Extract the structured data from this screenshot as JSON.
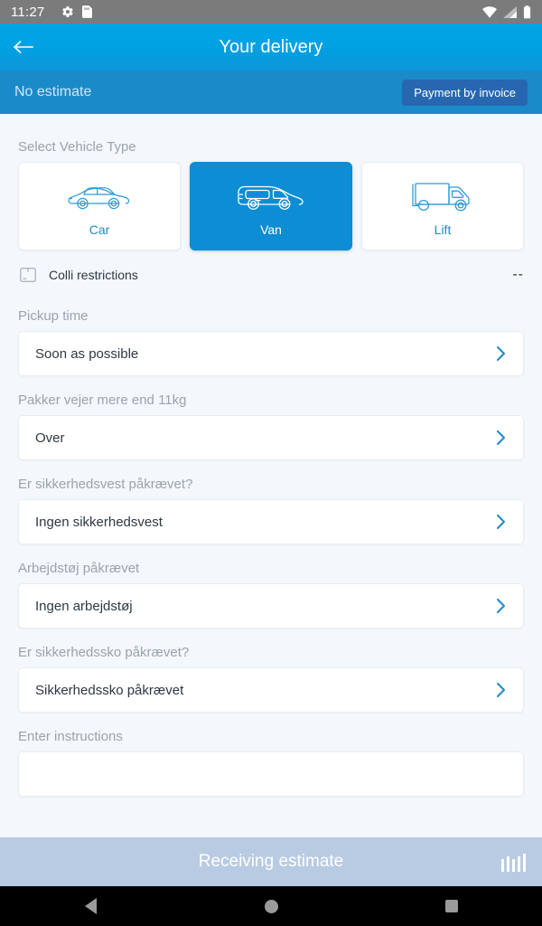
{
  "statusbar": {
    "time": "11:27",
    "icons_left": [
      "gear-icon",
      "sd-card-icon"
    ],
    "icons_right": [
      "wifi-icon",
      "signal-icon",
      "battery-icon"
    ]
  },
  "header": {
    "title": "Your delivery",
    "back_icon": "back-arrow-icon",
    "estimate_text": "No estimate",
    "payment_button": "Payment by invoice"
  },
  "vehicle_section": {
    "label": "Select Vehicle Type",
    "options": [
      {
        "label": "Car",
        "icon": "car-icon",
        "selected": false
      },
      {
        "label": "Van",
        "icon": "van-icon",
        "selected": true
      },
      {
        "label": "Lift",
        "icon": "lift-truck-icon",
        "selected": false
      }
    ]
  },
  "colli": {
    "icon": "box-icon",
    "label": "Colli restrictions",
    "value": "--"
  },
  "fields": [
    {
      "label": "Pickup time",
      "value": "Soon as possible"
    },
    {
      "label": "Pakker vejer mere end 11kg",
      "value": "Over"
    },
    {
      "label": "Er sikkerhedsvest påkrævet?",
      "value": "Ingen sikkerhedsvest"
    },
    {
      "label": "Arbejdstøj påkrævet",
      "value": "Ingen arbejdstøj"
    },
    {
      "label": "Er sikkerhedssko påkrævet?",
      "value": "Sikkerhedssko påkrævet"
    },
    {
      "label": "Enter instructions",
      "value": ""
    }
  ],
  "bottom_bar": {
    "text": "Receiving estimate",
    "spinner_icon": "loading-bars-icon"
  },
  "navbar": {
    "back": "nav-back-icon",
    "home": "nav-home-icon",
    "recents": "nav-recents-icon"
  },
  "colors": {
    "header_blue": "#00a0e2",
    "subheader_blue": "#1b8ac9",
    "accent_blue": "#0c8dd4",
    "invoice_button": "#2767b0",
    "bottom_bar": "#b8cbe3",
    "page_bg": "#f4f7fb"
  }
}
